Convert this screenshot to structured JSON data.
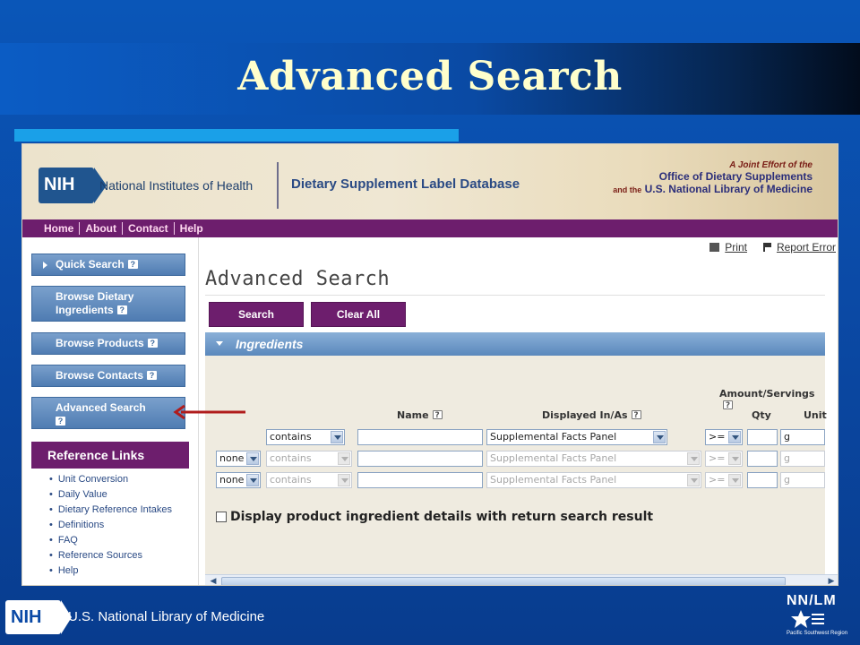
{
  "slide": {
    "title": "Advanced Search",
    "footer_org": "U.S. National Library of Medicine",
    "footer_logo": "NIH",
    "nnlm_title": "NN/LM",
    "nnlm_region": "Pacific Southwest Region"
  },
  "header": {
    "logo": "NIH",
    "org_name": "National Institutes of Health",
    "db_name": "Dietary Supplement Label Database",
    "joint_line1": "A Joint Effort of the",
    "joint_line2": "Office of Dietary Supplements",
    "joint_and": "and the",
    "joint_line3": "U.S. National Library of Medicine"
  },
  "nav": {
    "items": [
      {
        "label": "Home"
      },
      {
        "label": "About"
      },
      {
        "label": "Contact"
      },
      {
        "label": "Help"
      }
    ]
  },
  "sidebar": {
    "quick_search": "Quick Search",
    "browse_ingredients": "Browse Dietary Ingredients",
    "browse_products": "Browse Products",
    "browse_contacts": "Browse Contacts",
    "advanced_search": "Advanced Search",
    "reference_heading": "Reference Links",
    "reference_links": [
      "Unit Conversion",
      "Daily Value",
      "Dietary Reference Intakes",
      "Definitions",
      "FAQ",
      "Reference Sources",
      "Help"
    ]
  },
  "main": {
    "print_label": "Print",
    "report_error_label": "Report Error",
    "page_title": "Advanced Search",
    "search_button": "Search",
    "clear_button": "Clear All",
    "section_title": "Ingredients",
    "columns": {
      "amount": "Amount/Servings",
      "name": "Name",
      "displayed": "Displayed In/As",
      "qty": "Qty",
      "unit": "Unit"
    },
    "rows": [
      {
        "operator": "",
        "match": "contains",
        "name": "",
        "displayed": "Supplemental Facts Panel",
        "compare": ">=",
        "qty": "",
        "unit": "g"
      },
      {
        "operator": "none",
        "match": "contains",
        "name": "",
        "displayed": "Supplemental Facts Panel",
        "compare": ">=",
        "qty": "",
        "unit": "g"
      },
      {
        "operator": "none",
        "match": "contains",
        "name": "",
        "displayed": "Supplemental Facts Panel",
        "compare": ">=",
        "qty": "",
        "unit": "g"
      }
    ],
    "checkbox_label": "Display product ingredient details with return search result",
    "help_glyph": "?"
  },
  "colors": {
    "slide_blue": "#0b4aa6",
    "title_yellow": "#ffffcc",
    "purple": "#6d1e6d",
    "sidebar_blue": "#4f7cb2",
    "arrow_red": "#b01c1c"
  }
}
